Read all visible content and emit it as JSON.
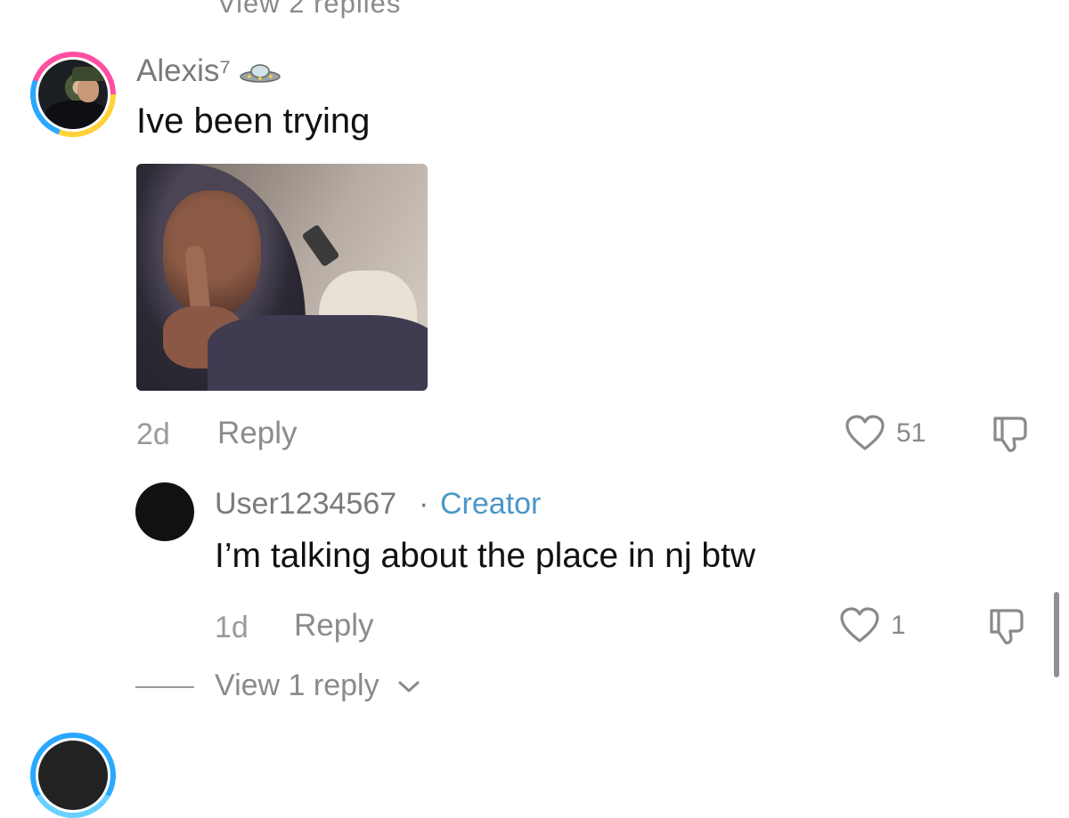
{
  "top": {
    "cut_text": "View 2 replies"
  },
  "comment1": {
    "username": "Alexis⁷",
    "text": "Ive been trying",
    "time": "2d",
    "reply_label": "Reply",
    "likes": "51",
    "icons": [
      "ufo-emoji-icon",
      "heart-icon",
      "dislike-icon"
    ]
  },
  "reply1": {
    "username": "User1234567",
    "separator": "·",
    "badge": "Creator",
    "text": "I’m talking about the place in nj btw",
    "time": "1d",
    "reply_label": "Reply",
    "likes": "1",
    "view_replies_label": "View 1 reply",
    "icons": [
      "heart-icon",
      "dislike-icon",
      "chevron-down-icon"
    ]
  },
  "colors": {
    "accent_creator": "#4a97c8",
    "text_primary": "#111111",
    "text_secondary": "#8a8a8a",
    "background": "#ffffff"
  }
}
